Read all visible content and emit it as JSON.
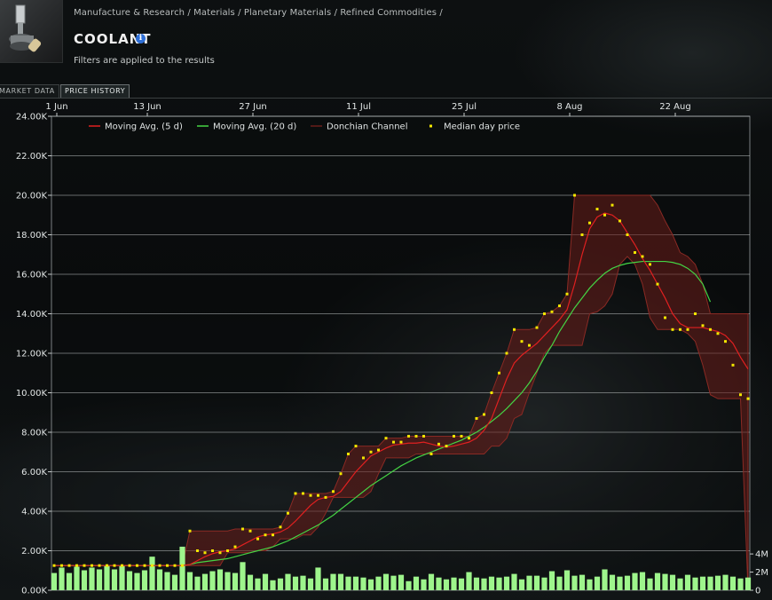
{
  "breadcrumb": "Manufacture & Research / Materials / Planetary Materials / Refined Commodities /",
  "item": {
    "name": "COOLANT",
    "info_icon": "i"
  },
  "filter_note": "Filters are applied to the results",
  "tabs": [
    {
      "label": "MARKET DATA"
    },
    {
      "label": "PRICE HISTORY"
    }
  ],
  "active_tab": "PRICE HISTORY",
  "colors": {
    "ma5": "#e02020",
    "ma20": "#44d444",
    "donchian": "#6a1e1a",
    "median": "#f2e600",
    "volume": "#9ef58c"
  },
  "chart_data": {
    "type": "line",
    "x_tick_labels": [
      "1 Jun",
      "13 Jun",
      "27 Jun",
      "11 Jul",
      "25 Jul",
      "8 Aug",
      "22 Aug"
    ],
    "y_tick_labels": [
      "0.00K",
      "2.00K",
      "4.00K",
      "6.00K",
      "8.00K",
      "10.00K",
      "12.00K",
      "14.00K",
      "16.00K",
      "18.00K",
      "20.00K",
      "22.00K",
      "24.00K"
    ],
    "ylim": [
      0,
      24000
    ],
    "volume_tick_labels": [
      "0",
      "2M",
      "4M"
    ],
    "volume_ylim": [
      0,
      4500000
    ],
    "legend": [
      {
        "name": "Moving Avg. (5 d)",
        "key": "ma5"
      },
      {
        "name": "Moving Avg. (20 d)",
        "key": "ma20"
      },
      {
        "name": "Donchian Channel",
        "key": "donchian"
      },
      {
        "name": "Median day price",
        "key": "median"
      }
    ],
    "median_price": [
      1250,
      1250,
      1250,
      1250,
      1250,
      1250,
      1250,
      1250,
      1250,
      1250,
      1250,
      1250,
      1250,
      1250,
      1250,
      1250,
      1250,
      1250,
      3000,
      2000,
      1900,
      2000,
      1900,
      2000,
      2200,
      3100,
      3000,
      2600,
      2800,
      2800,
      3200,
      3900,
      4900,
      4900,
      4800,
      4800,
      4700,
      5000,
      5900,
      6900,
      7300,
      6700,
      7000,
      7100,
      7700,
      7500,
      7500,
      7800,
      7800,
      7800,
      6900,
      7400,
      7300,
      7800,
      7800,
      7700,
      8700,
      8900,
      10000,
      11000,
      12000,
      13200,
      12600,
      12400,
      13300,
      14000,
      14100,
      14400,
      15000,
      20000,
      18000,
      18600,
      19300,
      19000,
      19500,
      18700,
      18000,
      17100,
      16900,
      16500,
      15500,
      13800,
      13200,
      13200,
      13200,
      14000,
      13400,
      13200,
      13000,
      12600,
      11400,
      9900,
      9700
    ],
    "ma5": [
      1250,
      1250,
      1250,
      1250,
      1250,
      1250,
      1250,
      1250,
      1250,
      1250,
      1250,
      1250,
      1250,
      1250,
      1250,
      1250,
      1250,
      1250,
      1300,
      1500,
      1700,
      1850,
      1950,
      2000,
      2100,
      2300,
      2500,
      2700,
      2800,
      2850,
      2950,
      3150,
      3500,
      3900,
      4300,
      4600,
      4700,
      4750,
      5000,
      5500,
      6000,
      6400,
      6800,
      7000,
      7200,
      7350,
      7400,
      7450,
      7450,
      7500,
      7400,
      7300,
      7250,
      7300,
      7400,
      7500,
      7700,
      8100,
      8700,
      9700,
      10700,
      11500,
      11900,
      12200,
      12500,
      12900,
      13300,
      13700,
      14200,
      15500,
      17000,
      18300,
      18900,
      19100,
      19000,
      18700,
      18100,
      17500,
      16800,
      16200,
      15500,
      14800,
      14000,
      13500,
      13300,
      13300,
      13300,
      13200,
      13100,
      12900,
      12500,
      11800,
      11200
    ],
    "ma20": [
      1250,
      1250,
      1250,
      1250,
      1250,
      1250,
      1250,
      1250,
      1250,
      1250,
      1250,
      1250,
      1250,
      1250,
      1250,
      1250,
      1250,
      1250,
      1300,
      1400,
      1450,
      1500,
      1550,
      1600,
      1700,
      1800,
      1900,
      2000,
      2100,
      2200,
      2350,
      2500,
      2700,
      2900,
      3100,
      3300,
      3550,
      3800,
      4100,
      4400,
      4700,
      5000,
      5300,
      5550,
      5800,
      6050,
      6300,
      6500,
      6700,
      6850,
      7000,
      7150,
      7300,
      7450,
      7600,
      7800,
      8000,
      8250,
      8550,
      8850,
      9200,
      9600,
      10000,
      10500,
      11100,
      11800,
      12400,
      13100,
      13700,
      14300,
      14800,
      15300,
      15700,
      16050,
      16300,
      16450,
      16550,
      16600,
      16650,
      16650,
      16650,
      16650,
      16600,
      16500,
      16300,
      16000,
      15500,
      14600
    ],
    "donchian_upper": [
      1250,
      1250,
      1250,
      1250,
      1250,
      1250,
      1250,
      1250,
      1250,
      1250,
      1250,
      1250,
      1250,
      1250,
      1250,
      1250,
      1250,
      1250,
      3000,
      3000,
      3000,
      3000,
      3000,
      3000,
      3100,
      3100,
      3100,
      3100,
      3100,
      3100,
      3200,
      3900,
      4900,
      4900,
      4900,
      4900,
      4900,
      5000,
      5900,
      6900,
      7300,
      7300,
      7300,
      7300,
      7700,
      7700,
      7700,
      7800,
      7800,
      7800,
      7800,
      7800,
      7800,
      7800,
      7800,
      7800,
      8700,
      8900,
      10000,
      11000,
      12000,
      13200,
      13200,
      13200,
      13300,
      14000,
      14100,
      14400,
      15000,
      20000,
      20000,
      20000,
      20000,
      20000,
      20000,
      20000,
      20000,
      20000,
      20000,
      20000,
      19500,
      18700,
      18000,
      17100,
      16900,
      16500,
      15500,
      14000,
      14000,
      14000,
      14000,
      14000,
      14000
    ],
    "donchian_lower": [
      1250,
      1250,
      1250,
      1250,
      1250,
      1250,
      1250,
      1250,
      1250,
      1250,
      1250,
      1250,
      1250,
      1250,
      1250,
      1250,
      1250,
      1250,
      1250,
      1250,
      1250,
      1250,
      1250,
      1900,
      1900,
      1900,
      1900,
      2000,
      2000,
      2200,
      2600,
      2600,
      2600,
      2800,
      2800,
      3200,
      3900,
      4700,
      4700,
      4700,
      4700,
      4700,
      5000,
      5900,
      6700,
      6700,
      6700,
      6700,
      6900,
      6900,
      6900,
      6900,
      6900,
      6900,
      6900,
      6900,
      6900,
      6900,
      7300,
      7300,
      7700,
      8700,
      8900,
      10000,
      11000,
      12000,
      12400,
      12400,
      12400,
      12400,
      12400,
      14000,
      14100,
      14400,
      15000,
      16500,
      16900,
      16500,
      15500,
      13800,
      13200,
      13200,
      13200,
      13200,
      13000,
      12600,
      11400,
      9900,
      9700,
      9700,
      9700,
      9700,
      0
    ],
    "volume": [
      1900000,
      2500000,
      1900000,
      2600000,
      2200000,
      2500000,
      2300000,
      2700000,
      2300000,
      2700000,
      2100000,
      1900000,
      2200000,
      3700000,
      2300000,
      2000000,
      1700000,
      4800000,
      2000000,
      1500000,
      1800000,
      2100000,
      2300000,
      2000000,
      1900000,
      3100000,
      1700000,
      1300000,
      1800000,
      1100000,
      1300000,
      1800000,
      1500000,
      1600000,
      1300000,
      2500000,
      1300000,
      1800000,
      1800000,
      1500000,
      1500000,
      1400000,
      1200000,
      1500000,
      1800000,
      1600000,
      1700000,
      1000000,
      1500000,
      1200000,
      1800000,
      1400000,
      1200000,
      1400000,
      1300000,
      2000000,
      1400000,
      1300000,
      1500000,
      1400000,
      1500000,
      1800000,
      1200000,
      1600000,
      1600000,
      1400000,
      2100000,
      1500000,
      2200000,
      1600000,
      1700000,
      1200000,
      1500000,
      2300000,
      1700000,
      1500000,
      1600000,
      1900000,
      2000000,
      1300000,
      1900000,
      1800000,
      1700000,
      1300000,
      1700000,
      1400000,
      1500000,
      1500000,
      1600000,
      1700000,
      1500000,
      1300000,
      1400000
    ]
  }
}
